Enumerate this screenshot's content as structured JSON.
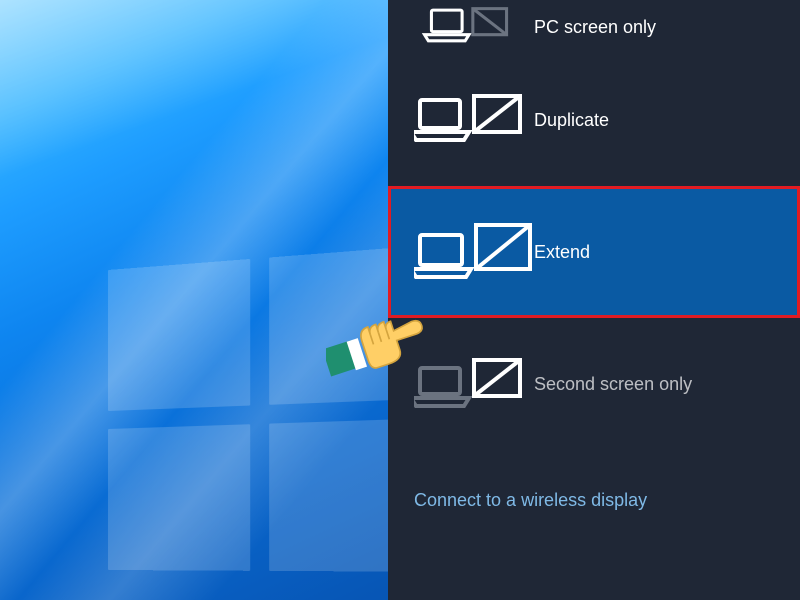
{
  "panel": {
    "options": {
      "pc_only": {
        "label": "PC screen only"
      },
      "duplicate": {
        "label": "Duplicate"
      },
      "extend": {
        "label": "Extend"
      },
      "second": {
        "label": "Second screen only"
      }
    },
    "wireless_link": "Connect to a wireless display"
  },
  "annotation": {
    "highlighted_option": "extend",
    "pointer_target": "extend"
  }
}
